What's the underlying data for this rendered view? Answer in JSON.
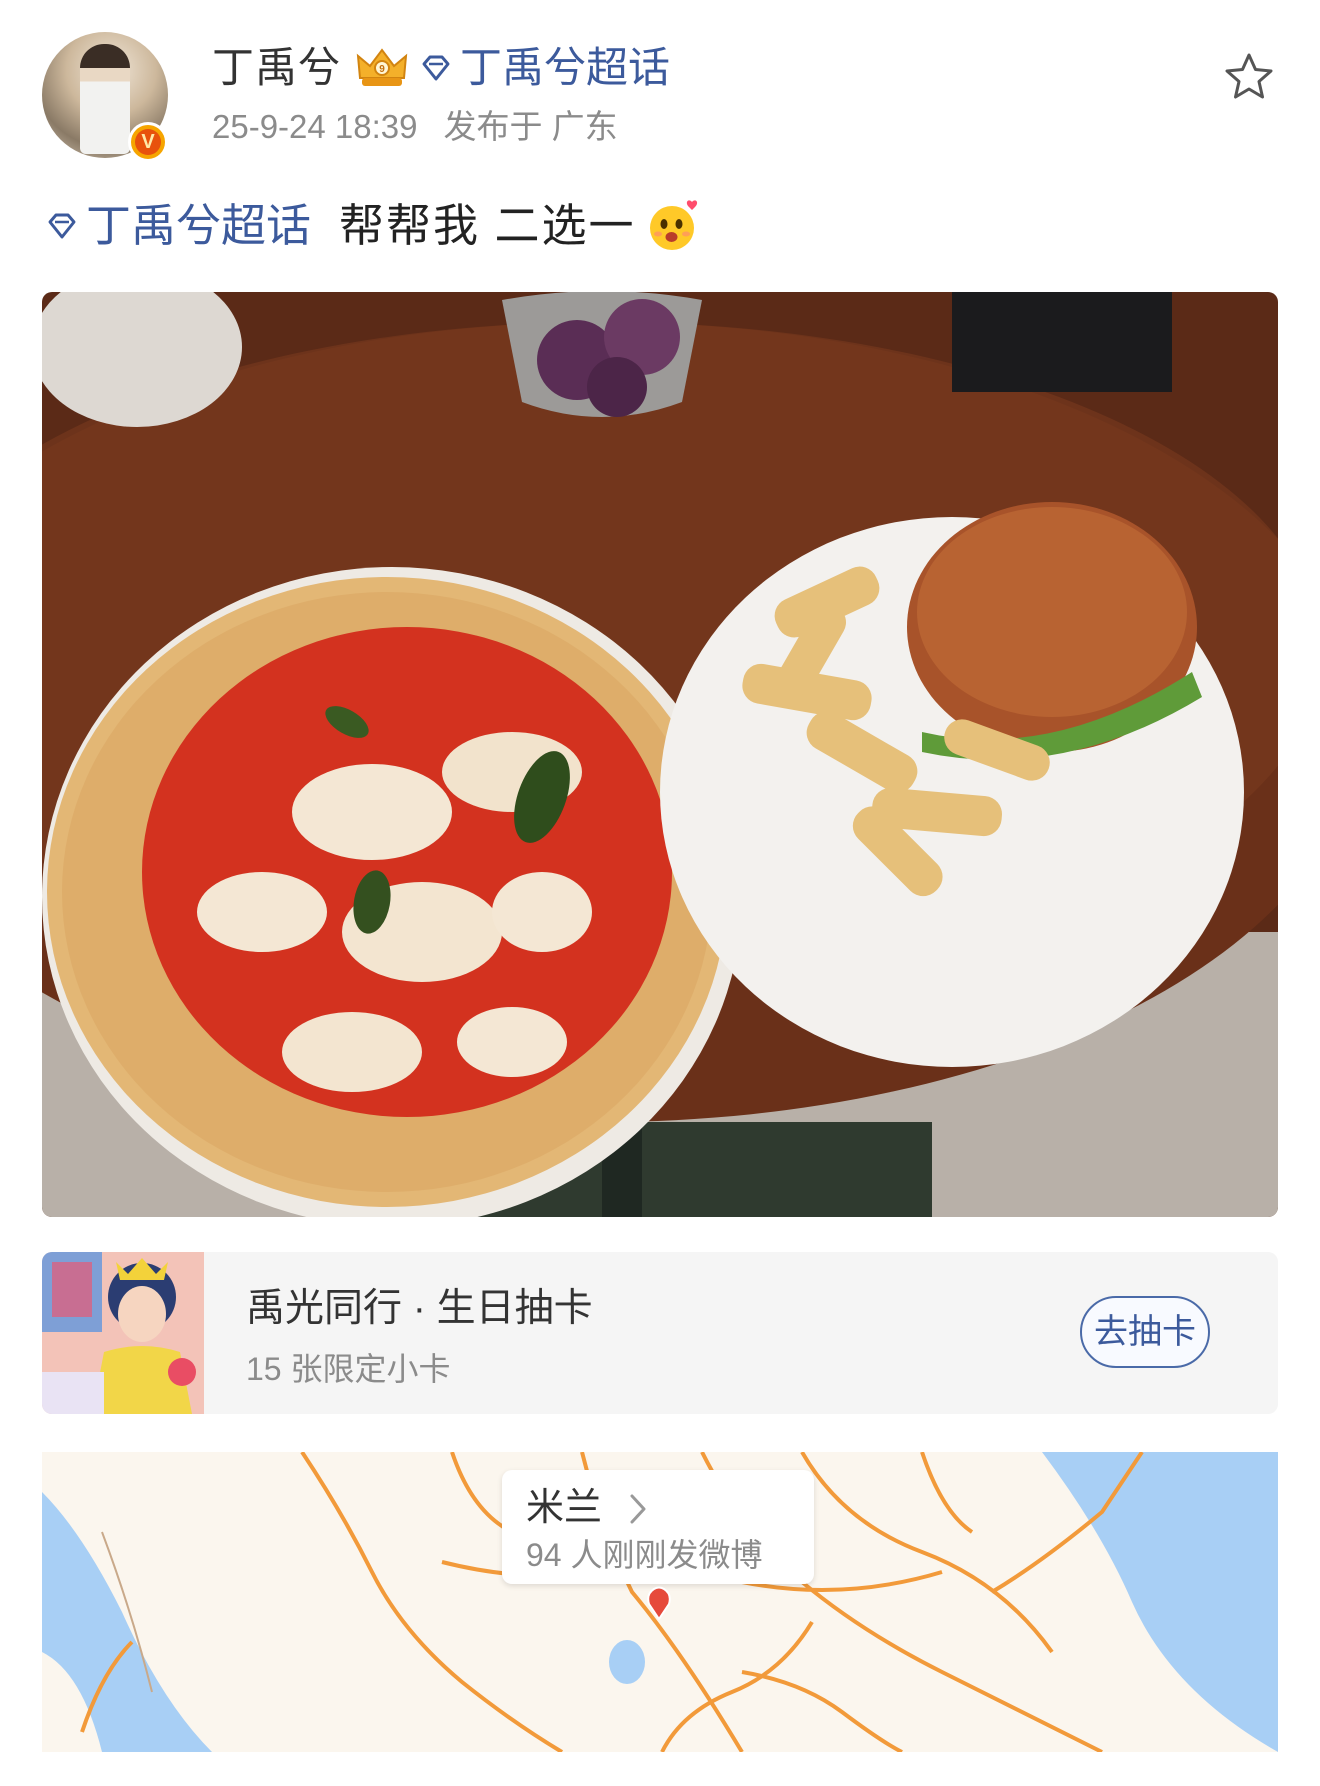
{
  "post": {
    "user": {
      "name": "丁禹兮",
      "topic": "丁禹兮超话",
      "verified_badge": "V"
    },
    "meta": {
      "time": "25-9-24 18:39",
      "location": "发布于 广东"
    },
    "text": {
      "topic": "丁禹兮超话",
      "body": "帮帮我  二选一"
    }
  },
  "card": {
    "title": "禹光同行 · 生日抽卡",
    "subtitle": "15 张限定小卡",
    "button": "去抽卡"
  },
  "map": {
    "city": "米兰",
    "count": "94 人刚刚发微博"
  },
  "colors": {
    "link": "#3c5a9c",
    "muted": "#8b8b8b",
    "map_water": "#a8cff5",
    "map_land": "#fbf6ee",
    "map_road": "#f29a3a"
  },
  "icons": [
    "star-icon",
    "diamond-topic-icon",
    "crown-icon",
    "verified-icon",
    "chevron-right-icon",
    "map-pin-icon",
    "emoji-icon"
  ]
}
